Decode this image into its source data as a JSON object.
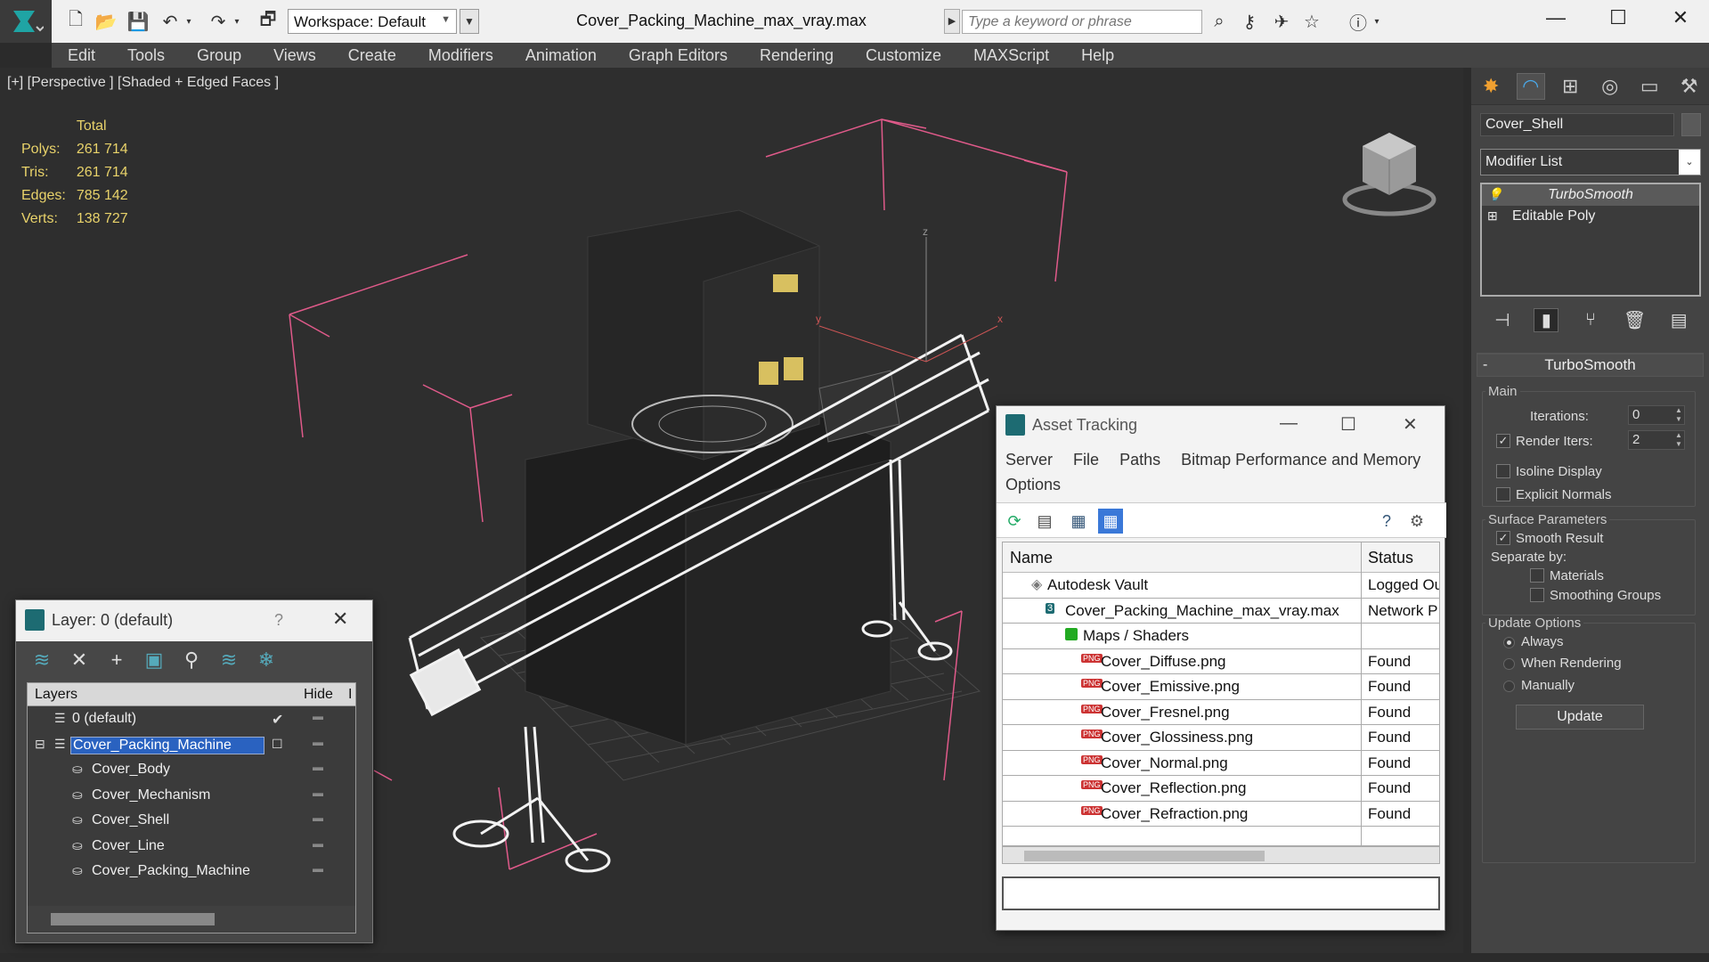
{
  "titlebar": {
    "workspace_label": "Workspace: Default",
    "document_title": "Cover_Packing_Machine_max_vray.max",
    "search_placeholder": "Type a keyword or phrase"
  },
  "menu": [
    "Edit",
    "Tools",
    "Group",
    "Views",
    "Create",
    "Modifiers",
    "Animation",
    "Graph Editors",
    "Rendering",
    "Customize",
    "MAXScript",
    "Help"
  ],
  "viewport": {
    "label": "[+] [Perspective ] [Shaded + Edged Faces ]",
    "stats": {
      "header": "Total",
      "rows": [
        {
          "label": "Polys:",
          "value": "261 714"
        },
        {
          "label": "Tris:",
          "value": "261 714"
        },
        {
          "label": "Edges:",
          "value": "785 142"
        },
        {
          "label": "Verts:",
          "value": "138 727"
        }
      ]
    },
    "gizmo_labels": {
      "z": "z",
      "x": "x",
      "y": "y"
    }
  },
  "command_panel": {
    "object_name": "Cover_Shell",
    "modifier_list_label": "Modifier List",
    "stack": [
      "TurboSmooth",
      "Editable Poly"
    ],
    "rollout_title": "TurboSmooth",
    "main": {
      "title": "Main",
      "iterations_label": "Iterations:",
      "iterations_value": "0",
      "render_iters_label": "Render Iters:",
      "render_iters_value": "2",
      "render_iters_checked": true,
      "isoline_label": "Isoline Display",
      "explicit_normals_label": "Explicit Normals"
    },
    "surface": {
      "title": "Surface Parameters",
      "smooth_result_label": "Smooth Result",
      "separate_by_label": "Separate by:",
      "materials_label": "Materials",
      "smoothing_groups_label": "Smoothing Groups"
    },
    "update": {
      "title": "Update Options",
      "always_label": "Always",
      "when_rendering_label": "When Rendering",
      "manually_label": "Manually",
      "button_label": "Update"
    }
  },
  "layer_dialog": {
    "title": "Layer: 0 (default)",
    "help": "?",
    "col_layers": "Layers",
    "col_hide": "Hide",
    "col_extra": "I",
    "rows": [
      {
        "name": "0 (default)",
        "indent": 0,
        "type": "layer",
        "active": true
      },
      {
        "name": "Cover_Packing_Machine",
        "indent": 0,
        "type": "layer",
        "selected": true
      },
      {
        "name": "Cover_Body",
        "indent": 1,
        "type": "object"
      },
      {
        "name": "Cover_Mechanism",
        "indent": 1,
        "type": "object"
      },
      {
        "name": "Cover_Shell",
        "indent": 1,
        "type": "object"
      },
      {
        "name": "Cover_Line",
        "indent": 1,
        "type": "object"
      },
      {
        "name": "Cover_Packing_Machine",
        "indent": 1,
        "type": "object"
      }
    ]
  },
  "asset_dialog": {
    "title": "Asset Tracking",
    "menu": [
      "Server",
      "File",
      "Paths",
      "Bitmap Performance and Memory",
      "Options"
    ],
    "col_name": "Name",
    "col_status": "Status",
    "rows": [
      {
        "name": "Autodesk Vault",
        "status": "Logged Ou",
        "icon": "vault"
      },
      {
        "name": "Cover_Packing_Machine_max_vray.max",
        "status": "Network P",
        "icon": "max"
      },
      {
        "name": "Maps / Shaders",
        "status": "",
        "icon": "folder"
      },
      {
        "name": "Cover_Diffuse.png",
        "status": "Found",
        "icon": "png"
      },
      {
        "name": "Cover_Emissive.png",
        "status": "Found",
        "icon": "png"
      },
      {
        "name": "Cover_Fresnel.png",
        "status": "Found",
        "icon": "png"
      },
      {
        "name": "Cover_Glossiness.png",
        "status": "Found",
        "icon": "png"
      },
      {
        "name": "Cover_Normal.png",
        "status": "Found",
        "icon": "png"
      },
      {
        "name": "Cover_Reflection.png",
        "status": "Found",
        "icon": "png"
      },
      {
        "name": "Cover_Refraction.png",
        "status": "Found",
        "icon": "png"
      }
    ],
    "png_badge": "PNG",
    "max_badge": "3"
  },
  "colors": {
    "accent": "#2a62c0",
    "stats_text": "#e8d26a",
    "bbox_lines": "#e05a8a",
    "viewport_bg": "#2e2e2e"
  }
}
